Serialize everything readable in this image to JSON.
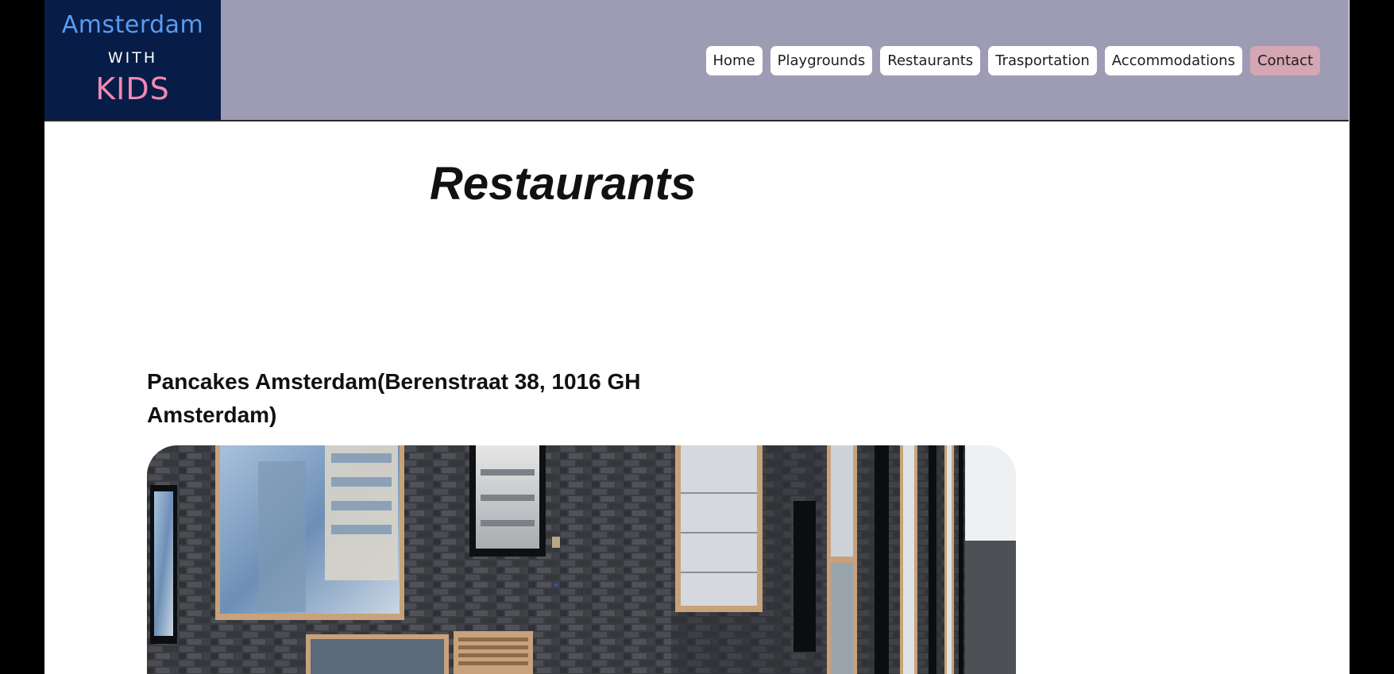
{
  "logo": {
    "line1": "Amsterdam",
    "line2": "WITH",
    "line3": "KIDS"
  },
  "nav": {
    "items": [
      {
        "label": "Home"
      },
      {
        "label": "Playgrounds"
      },
      {
        "label": "Restaurants"
      },
      {
        "label": "Trasportation"
      },
      {
        "label": "Accommodations"
      },
      {
        "label": "Contact"
      }
    ]
  },
  "main": {
    "title": "Restaurants",
    "restaurant": {
      "name": "Pancakes Amsterdam(Berenstraat 38, 1016 GH Amsterdam)"
    }
  },
  "colors": {
    "header_bg": "#9e9cb5",
    "logo_bg": "#071c46",
    "logo_blue": "#5a9cf2",
    "logo_pink": "#f089b4",
    "contact_bg": "#d5a6b3"
  }
}
